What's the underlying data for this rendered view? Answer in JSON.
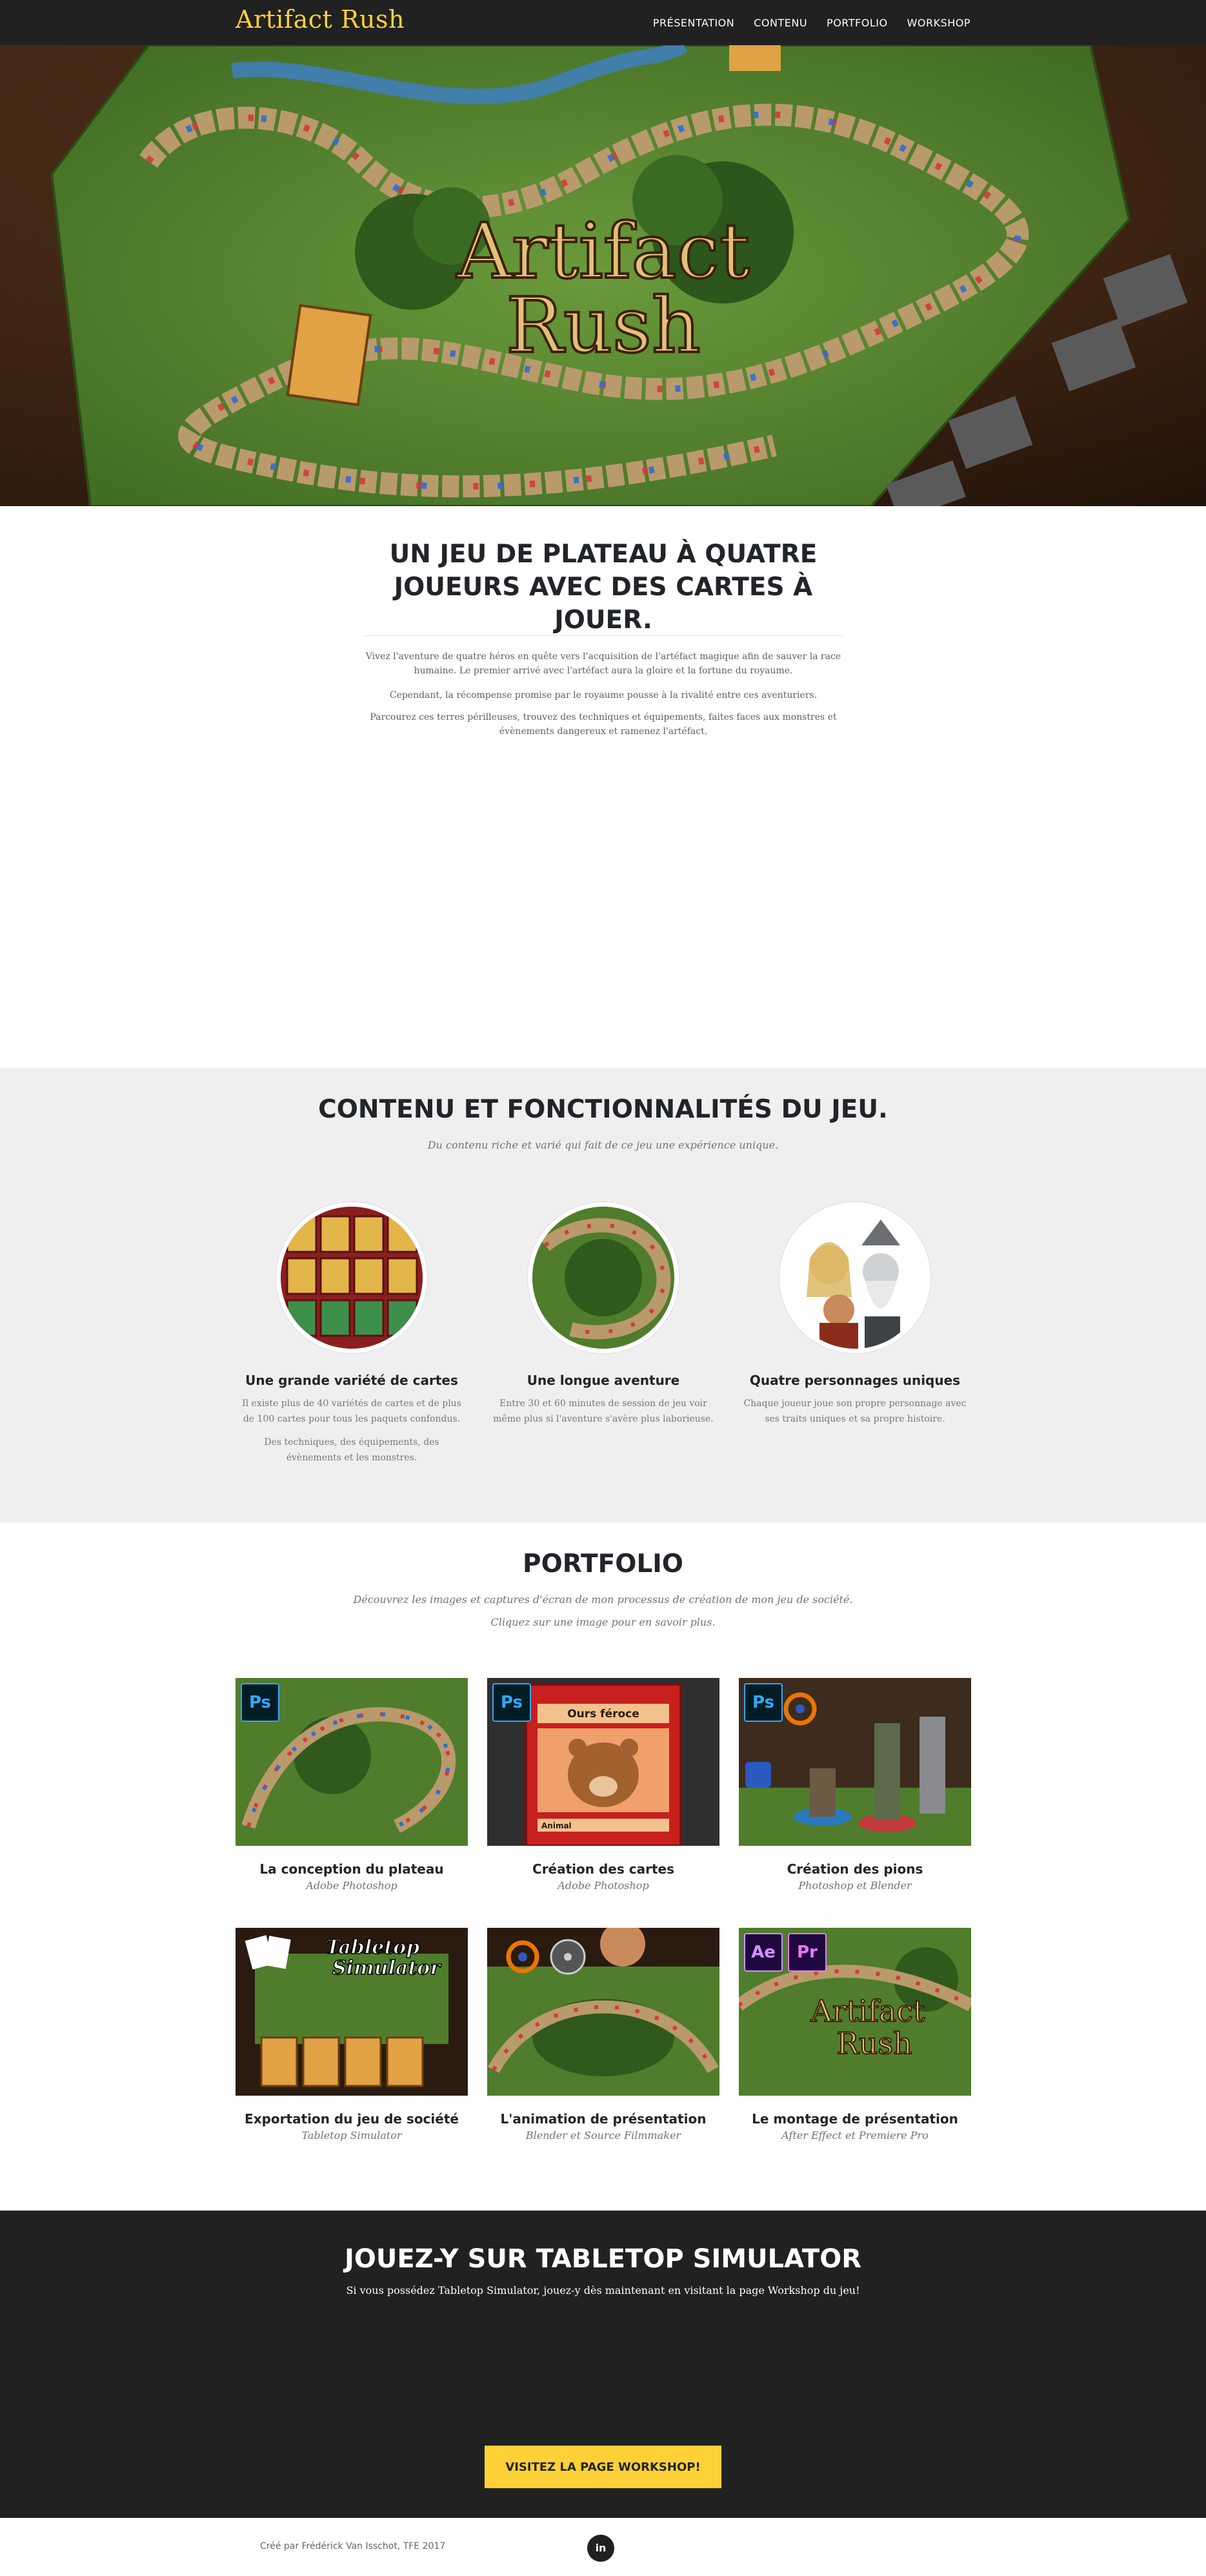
{
  "nav": {
    "brand": "Artifact Rush",
    "links": [
      "PRÉSENTATION",
      "CONTENU",
      "PORTFOLIO",
      "WORKSHOP"
    ]
  },
  "hero": {
    "logo_line1": "Artifact",
    "logo_line2": "Rush"
  },
  "about": {
    "title": "UN JEU DE PLATEAU À QUATRE JOUEURS AVEC DES CARTES À JOUER.",
    "paragraphs": [
      "Vivez l'aventure de quatre héros en quête vers l'acquisition de l'artéfact magique afin de sauver la race humaine. Le premier arrivé avec l'artéfact aura la gloire et la fortune du royaume.",
      "Cependant, la récompense promise par le royaume pousse à la rivalité entre ces aventuriers.",
      "Parcourez ces terres périlleuses, trouvez des techniques et équipements, faites faces aux monstres et évènements dangereux et ramenez l'artéfact."
    ]
  },
  "services": {
    "title": "CONTENU ET FONCTIONNALITÉS DU JEU.",
    "subtitle": "Du contenu riche et varié qui fait de ce jeu une expérience unique.",
    "items": [
      {
        "title": "Une grande variété de cartes",
        "text1": "Il existe plus de 40 variétés de cartes et de plus de 100 cartes pour tous les paquets confondus.",
        "text2": "Des techniques, des équipements, des évènements et les monstres."
      },
      {
        "title": "Une longue aventure",
        "text1": "Entre 30 et 60 minutes de session de jeu voir même plus si l'aventure s'avère plus laborieuse.",
        "text2": ""
      },
      {
        "title": "Quatre personnages uniques",
        "text1": "Chaque joueur joue son propre personnage avec ses traits uniques et sa propre histoire.",
        "text2": ""
      }
    ]
  },
  "portfolio": {
    "title": "PORTFOLIO",
    "subtitle1": "Découvrez les images et captures d'écran de mon processus de création de mon jeu de société.",
    "subtitle2": "Cliquez sur une image pour en savoir plus.",
    "items": [
      {
        "title": "La conception du plateau",
        "caption": "Adobe Photoshop",
        "tags": [
          "Ps"
        ]
      },
      {
        "title": "Création des cartes",
        "caption": "Adobe Photoshop",
        "tags": [
          "Ps"
        ],
        "card_name": "Ours féroce",
        "card_type": "Animal"
      },
      {
        "title": "Création des pions",
        "caption": "Photoshop et Blender",
        "tags": [
          "Ps"
        ]
      },
      {
        "title": "Exportation du jeu de société",
        "caption": "Tabletop Simulator",
        "logo_line1": "Tabletop",
        "logo_line2": "Simulator"
      },
      {
        "title": "L'animation de présentation",
        "caption": "Blender et Source Filmmaker",
        "tags": []
      },
      {
        "title": "Le montage de présentation",
        "caption": "After Effect et Premiere Pro",
        "tags": [
          "Ae",
          "Pr"
        ],
        "logo_line1": "Artifact",
        "logo_line2": "Rush"
      }
    ]
  },
  "workshop": {
    "title": "JOUEZ-Y SUR TABLETOP SIMULATOR",
    "text": "Si vous possédez Tabletop Simulator, jouez-y dès maintenant en visitant la page Workshop du jeu!",
    "button": "VISITEZ LA PAGE WORKSHOP!"
  },
  "footer": {
    "copyright": "Créé par Frédérick Van Isschot, TFE 2017",
    "social_icon": "in"
  },
  "colors": {
    "accent": "#fed136",
    "dark": "#212121",
    "light_section": "#efefef"
  }
}
